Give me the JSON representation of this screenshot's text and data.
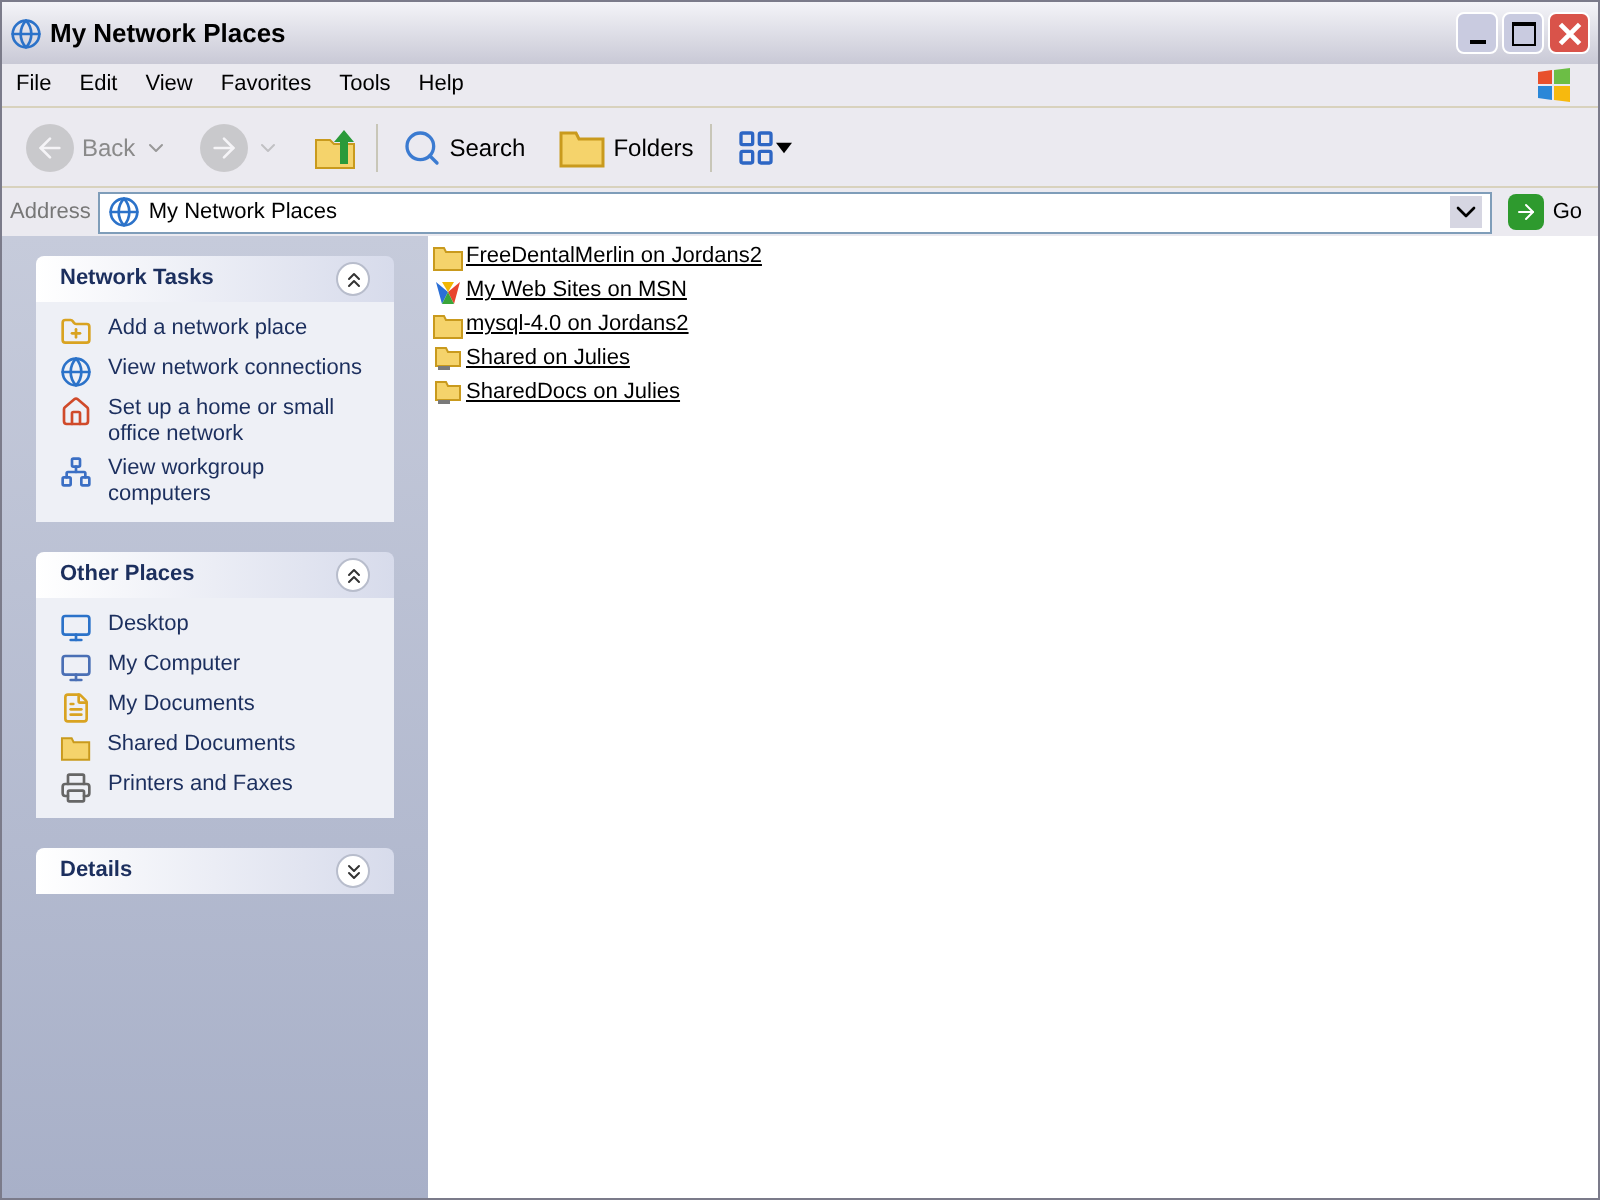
{
  "window": {
    "title": "My Network Places"
  },
  "menu": [
    "File",
    "Edit",
    "View",
    "Favorites",
    "Tools",
    "Help"
  ],
  "toolbar": [
    {
      "kind": "back",
      "label": "Back",
      "disabled": true
    },
    {
      "kind": "forward",
      "disabled": true
    },
    {
      "kind": "up"
    },
    {
      "kind": "search",
      "label": "Search"
    },
    {
      "kind": "folders",
      "label": "Folders"
    },
    {
      "kind": "views"
    }
  ],
  "address": {
    "label": "Address",
    "value": "My Network Places",
    "go": "Go"
  },
  "panels": [
    {
      "title": "Network Tasks",
      "expanded": true,
      "items": [
        "Add a network place",
        "View network connections",
        "Set up a home or small office network",
        "View workgroup computers"
      ]
    },
    {
      "title": "Other Places",
      "expanded": true,
      "items": [
        "Desktop",
        "My Computer",
        "My Documents",
        "Shared Documents",
        "Printers and Faxes"
      ]
    },
    {
      "title": "Details",
      "expanded": false
    }
  ],
  "files": [
    {
      "name": "FreeDentalMerlin on Jordans2",
      "kind": "folder"
    },
    {
      "name": "My Web Sites on MSN",
      "kind": "msn"
    },
    {
      "name": "mysql-4.0 on Jordans2",
      "kind": "folder"
    },
    {
      "name": "Shared on Julies",
      "kind": "share"
    },
    {
      "name": "SharedDocs on Julies",
      "kind": "share"
    }
  ]
}
